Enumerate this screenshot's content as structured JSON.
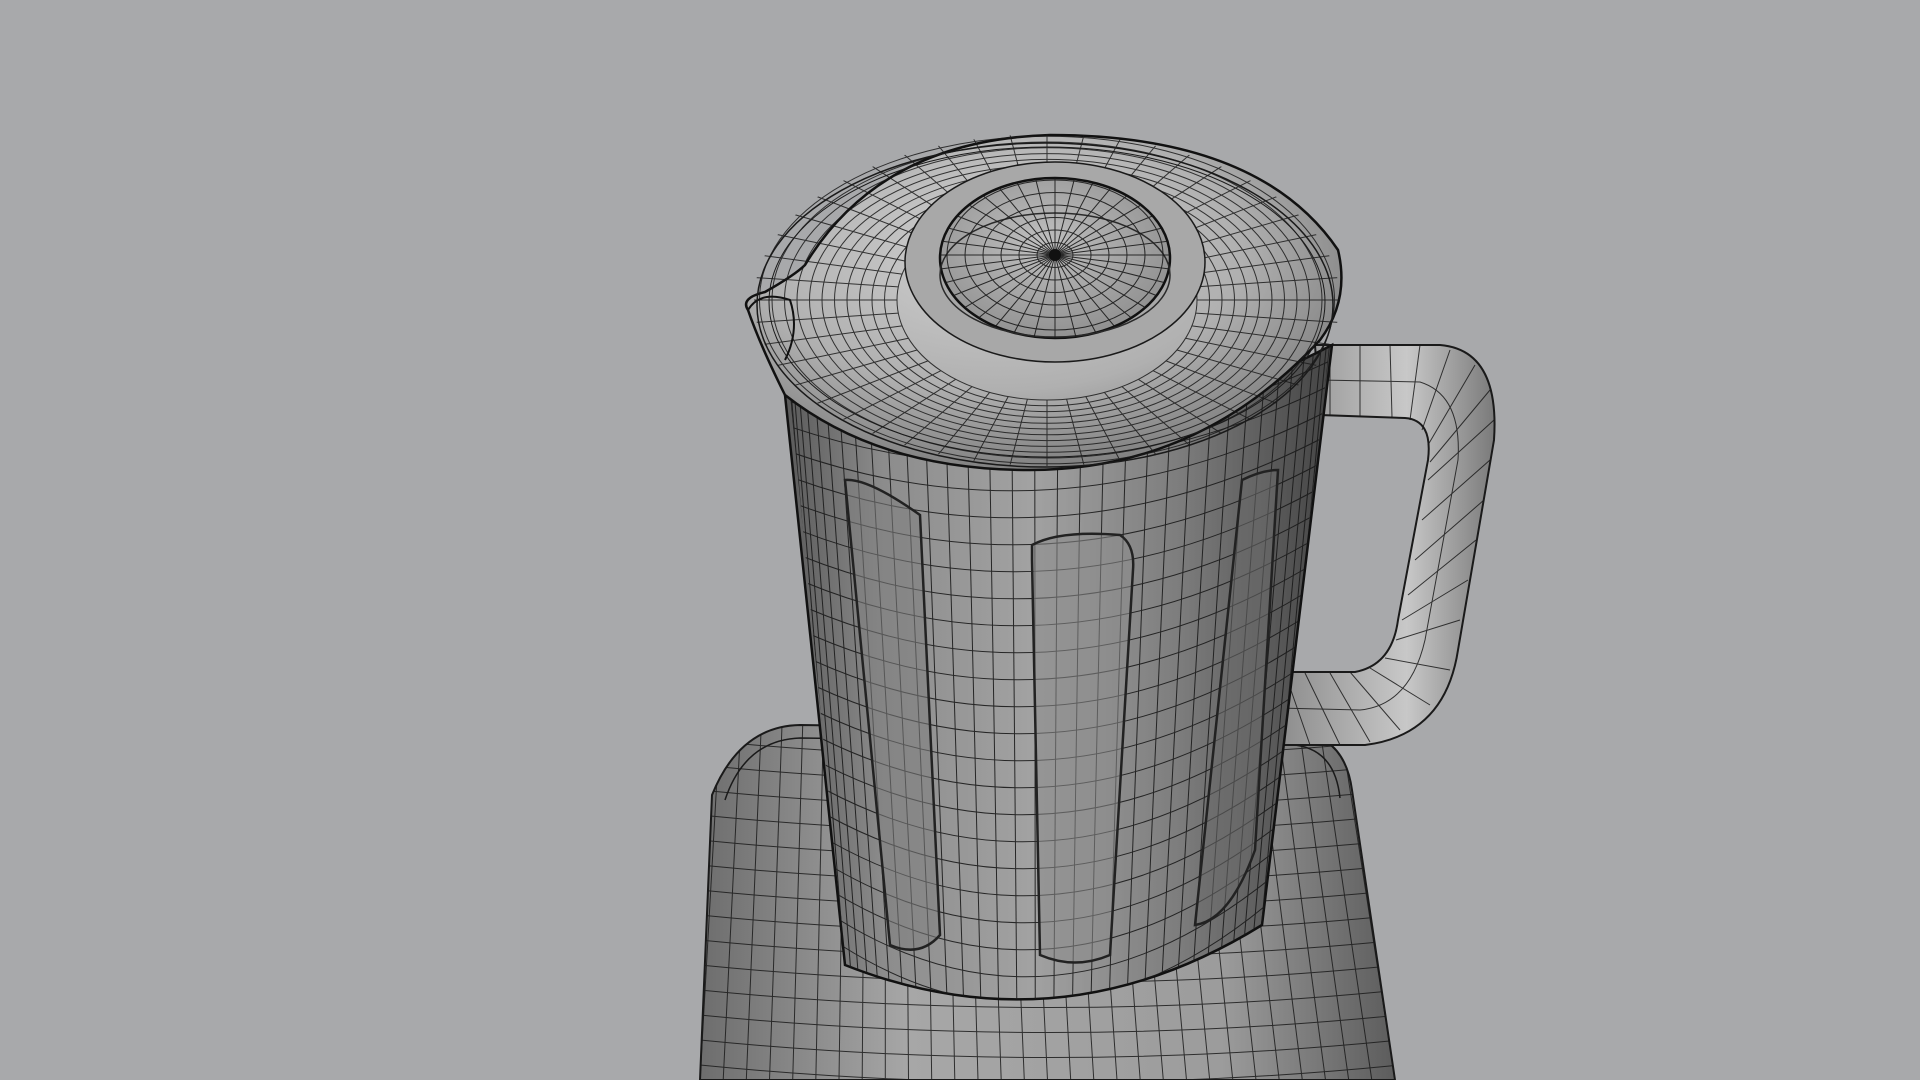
{
  "viewport": {
    "background_color": "#a8a9ab",
    "display_mode": "wireframe-on-shaded",
    "objects": [
      {
        "name": "blender-jar"
      },
      {
        "name": "jar-lid"
      },
      {
        "name": "lid-center-cap"
      },
      {
        "name": "jar-handle"
      },
      {
        "name": "blender-base"
      }
    ]
  },
  "colors": {
    "surface_light": "#c4c4c4",
    "surface_mid": "#8d8d8d",
    "surface_dark": "#4a4a4a",
    "wire": "#161616"
  }
}
